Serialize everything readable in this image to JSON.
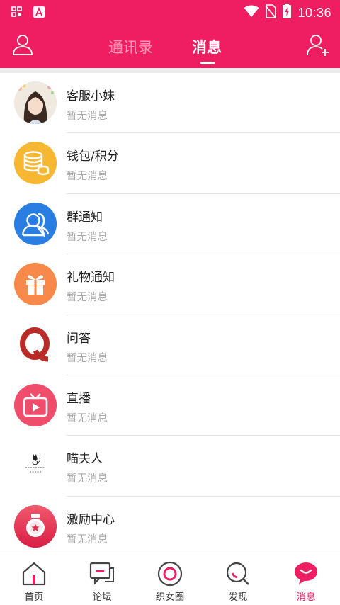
{
  "status_bar": {
    "time": "10:36",
    "icons": [
      "app-grid-icon",
      "font-app-icon",
      "wifi-icon",
      "no-sim-icon",
      "battery-charging-icon"
    ]
  },
  "header": {
    "tabs": [
      {
        "label": "通讯录",
        "active": false
      },
      {
        "label": "消息",
        "active": true
      }
    ],
    "left_icon": "profile-icon",
    "right_icon": "add-friend-icon",
    "accent_color": "#ef1e63"
  },
  "messages": [
    {
      "title": "客服小妹",
      "subtitle": "暂无消息",
      "icon": "customer-service-avatar"
    },
    {
      "title": "钱包/积分",
      "subtitle": "暂无消息",
      "icon": "coins-icon"
    },
    {
      "title": "群通知",
      "subtitle": "暂无消息",
      "icon": "group-icon"
    },
    {
      "title": "礼物通知",
      "subtitle": "暂无消息",
      "icon": "gift-icon"
    },
    {
      "title": "问答",
      "subtitle": "暂无消息",
      "icon": "qa-icon"
    },
    {
      "title": "直播",
      "subtitle": "暂无消息",
      "icon": "live-tv-icon"
    },
    {
      "title": "喵夫人",
      "subtitle": "暂无消息",
      "icon": "cat-lady-logo"
    },
    {
      "title": "激励中心",
      "subtitle": "暂无消息",
      "icon": "incentive-icon"
    }
  ],
  "bottom_nav": [
    {
      "label": "首页",
      "icon": "home-icon",
      "active": false
    },
    {
      "label": "论坛",
      "icon": "forum-icon",
      "active": false
    },
    {
      "label": "织女圈",
      "icon": "circle-icon",
      "active": false
    },
    {
      "label": "发现",
      "icon": "discover-icon",
      "active": false
    },
    {
      "label": "消息",
      "icon": "message-icon",
      "active": true
    }
  ]
}
